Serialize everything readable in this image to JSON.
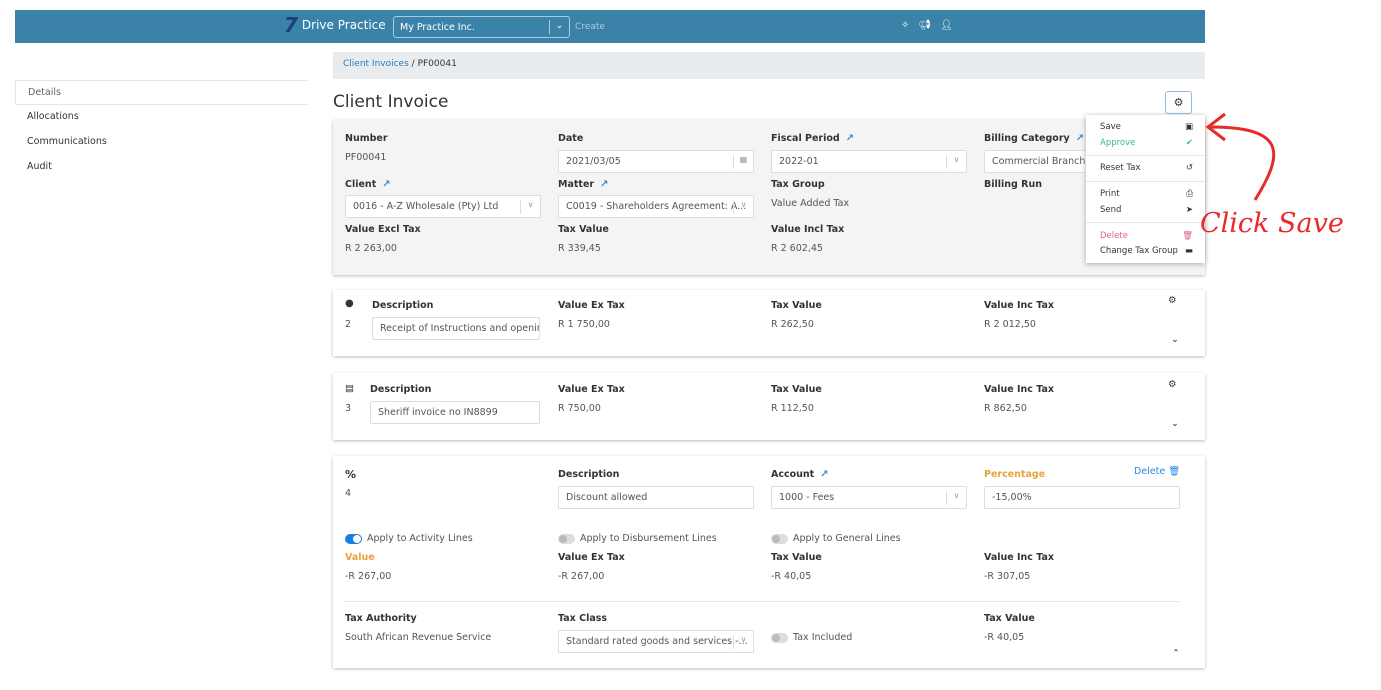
{
  "header": {
    "brand": "Drive Practice",
    "practice": "My Practice Inc.",
    "create": "Create",
    "icons": [
      "magic-icon",
      "megaphone-icon",
      "user-icon"
    ]
  },
  "sidebar": {
    "items": [
      {
        "label": "Details"
      },
      {
        "label": "Allocations"
      },
      {
        "label": "Communications"
      },
      {
        "label": "Audit"
      }
    ]
  },
  "breadcrumb": {
    "parent": "Client Invoices",
    "current": "PF00041"
  },
  "page_title": "Client Invoice",
  "invoice": {
    "number_label": "Number",
    "number": "PF00041",
    "date_label": "Date",
    "date": "2021/03/05",
    "fiscal_label": "Fiscal Period",
    "fiscal": "2022-01",
    "billing_cat_label": "Billing Category",
    "billing_cat": "Commercial Branch A",
    "client_label": "Client",
    "client": "0016 - A-Z Wholesale (Pty) Ltd",
    "matter_label": "Matter",
    "matter": "C0019 - Shareholders Agreement: A...",
    "taxgroup_label": "Tax Group",
    "taxgroup": "Value Added Tax",
    "billing_run_label": "Billing Run",
    "vex_label": "Value Excl Tax",
    "vex": "R 2 263,00",
    "tax_label": "Tax Value",
    "tax": "R 339,45",
    "vinc_label": "Value Incl Tax",
    "vinc": "R 2 602,45"
  },
  "lines": [
    {
      "no": "2",
      "desc_label": "Description",
      "desc": "Receipt of Instructions and opening",
      "vex_label": "Value Ex Tax",
      "vex": "R 1 750,00",
      "tax_label": "Tax Value",
      "tax": "R 262,50",
      "vinc_label": "Value Inc Tax",
      "vinc": "R 2 012,50"
    },
    {
      "no": "3",
      "desc_label": "Description",
      "desc": "Sheriff invoice no IN8899",
      "vex_label": "Value Ex Tax",
      "vex": "R 750,00",
      "tax_label": "Tax Value",
      "tax": "R 112,50",
      "vinc_label": "Value Inc Tax",
      "vinc": "R 862,50"
    }
  ],
  "discount": {
    "symbol": "%",
    "no": "4",
    "desc_label": "Description",
    "desc": "Discount allowed",
    "account_label": "Account",
    "account": "1000 - Fees",
    "pct_label": "Percentage",
    "pct": "-15,00%",
    "delete": "Delete",
    "apply_activity": "Apply to Activity Lines",
    "apply_activity_on": true,
    "apply_disb": "Apply to Disbursement Lines",
    "apply_disb_on": false,
    "apply_general": "Apply to General Lines",
    "apply_general_on": false,
    "value_label": "Value",
    "value": "-R 267,00",
    "vex_label": "Value Ex Tax",
    "vex": "-R 267,00",
    "tax_label": "Tax Value",
    "tax": "-R 40,05",
    "vinc_label": "Value Inc Tax",
    "vinc": "-R 307,05",
    "authority_label": "Tax Authority",
    "authority": "South African Revenue Service",
    "taxclass_label": "Tax Class",
    "taxclass": "Standard rated goods and services -...",
    "taxincl": "Tax Included",
    "taxincl_on": false,
    "taxval_label": "Tax Value",
    "taxval": "-R 40,05"
  },
  "menu": {
    "save": "Save",
    "approve": "Approve",
    "reset": "Reset Tax",
    "print": "Print",
    "send": "Send",
    "delete": "Delete",
    "change": "Change Tax Group"
  },
  "annotation": "Click Save",
  "colors": {
    "header": "#3a82a8",
    "approve": "#3bb58a",
    "delete": "#e06680",
    "accent": "#1a7de0",
    "annotation": "#e8292b"
  }
}
